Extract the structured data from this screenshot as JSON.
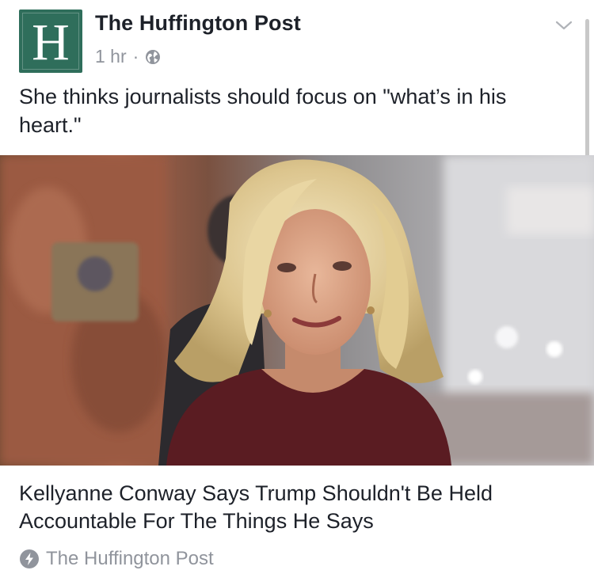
{
  "post": {
    "page_name": "The Huffington Post",
    "avatar_letter": "H",
    "timestamp": "1 hr",
    "separator": "·",
    "privacy_icon": "globe-icon",
    "menu_icon": "chevron-down-icon",
    "text": "She thinks journalists should focus on \"what’s in his heart.\""
  },
  "link": {
    "headline": "Kellyanne Conway Says Trump Shouldn't Be Held Accountable For The Things He Says",
    "source": "The Huffington Post",
    "source_icon": "instant-article-bolt-icon"
  },
  "colors": {
    "brand": "#2f6e5b",
    "text": "#1d2129",
    "meta": "#90949c"
  }
}
